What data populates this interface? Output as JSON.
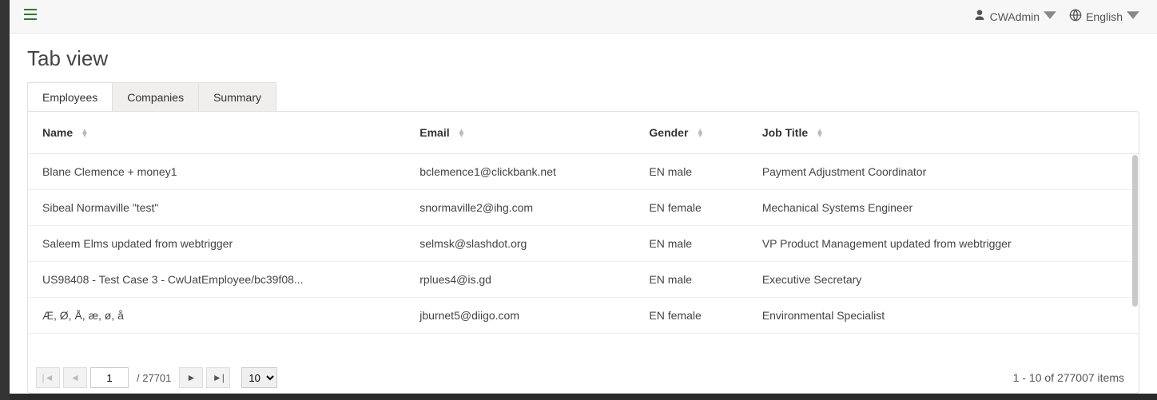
{
  "header": {
    "user_label": "CWAdmin",
    "language_label": "English"
  },
  "page": {
    "title": "Tab view"
  },
  "tabs": [
    {
      "label": "Employees",
      "active": true
    },
    {
      "label": "Companies",
      "active": false
    },
    {
      "label": "Summary",
      "active": false
    }
  ],
  "grid": {
    "columns": [
      {
        "label": "Name"
      },
      {
        "label": "Email"
      },
      {
        "label": "Gender"
      },
      {
        "label": "Job Title"
      }
    ],
    "rows": [
      {
        "name": "Blane Clemence + money1",
        "email": "bclemence1@clickbank.net",
        "gender": "EN male",
        "job": "Payment Adjustment Coordinator"
      },
      {
        "name": "Sibeal Normaville \"test\"",
        "email": "snormaville2@ihg.com",
        "gender": "EN female",
        "job": "Mechanical Systems Engineer"
      },
      {
        "name": "Saleem Elms updated from webtrigger",
        "email": "selmsk@slashdot.org",
        "gender": "EN male",
        "job": "VP Product Management updated from webtrigger"
      },
      {
        "name": "US98408 - Test Case 3 - CwUatEmployee/bc39f08...",
        "email": "rplues4@is.gd",
        "gender": "EN male",
        "job": "Executive Secretary"
      },
      {
        "name": "Æ, Ø, Å, æ, ø, å",
        "email": "jburnet5@diigo.com",
        "gender": "EN female",
        "job": "Environmental Specialist"
      }
    ]
  },
  "pager": {
    "current_page": "1",
    "total_pages": "27701",
    "page_size": "10",
    "summary": "1 - 10 of 277007 items",
    "of_prefix": "/ "
  }
}
